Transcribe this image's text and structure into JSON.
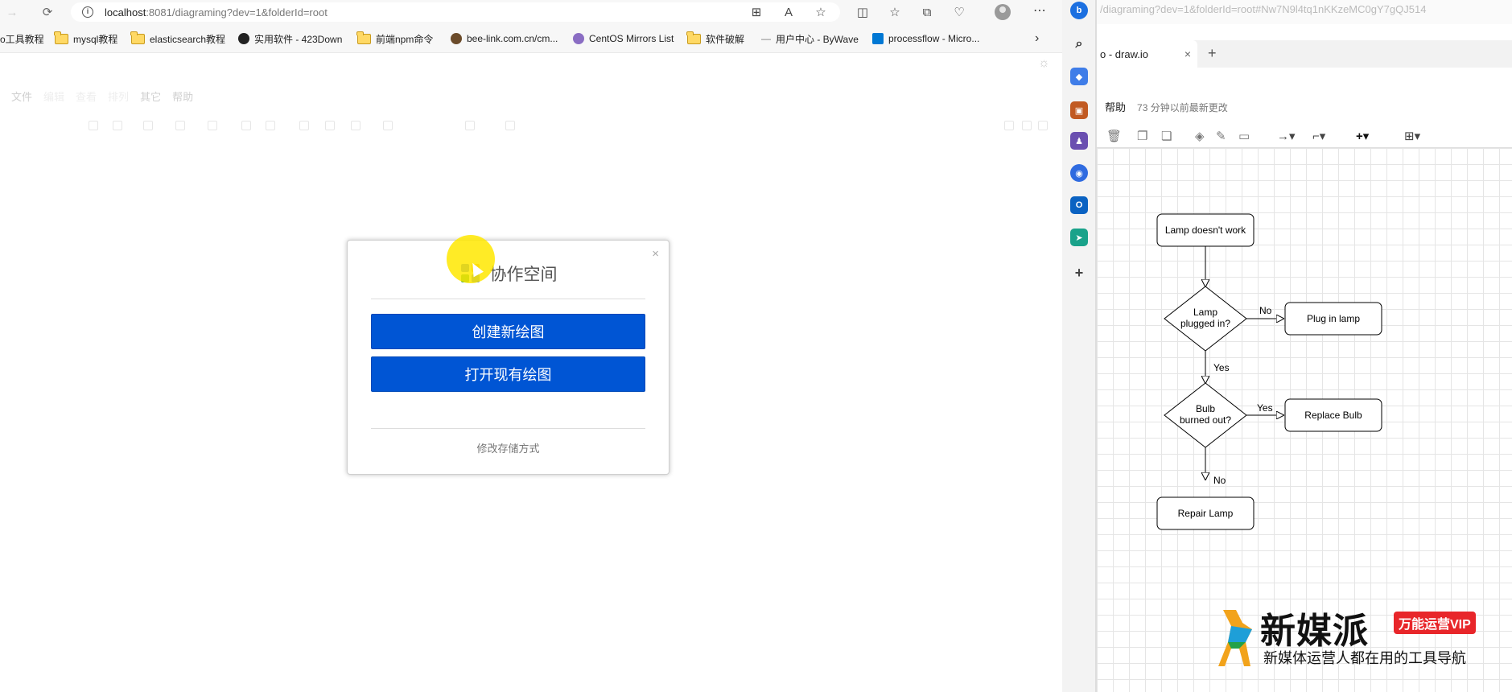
{
  "browser": {
    "url_host": "localhost",
    "url_rest": ":8081/diagraming?dev=1&folderId=root",
    "bookmarks": [
      {
        "label": "o工具教程",
        "icon": "folder"
      },
      {
        "label": "mysql教程",
        "icon": "folder"
      },
      {
        "label": "elasticsearch教程",
        "icon": "folder"
      },
      {
        "label": "实用软件 - 423Down",
        "icon": "site"
      },
      {
        "label": "前端npm命令",
        "icon": "folder"
      },
      {
        "label": "bee-link.com.cn/cm...",
        "icon": "site"
      },
      {
        "label": "CentOS Mirrors List",
        "icon": "site"
      },
      {
        "label": "软件破解",
        "icon": "folder"
      },
      {
        "label": "用户中心 - ByWave",
        "icon": "site"
      },
      {
        "label": "processflow - Micro...",
        "icon": "site"
      }
    ]
  },
  "app": {
    "menu": [
      "文件",
      "编辑",
      "查看",
      "排列",
      "其它",
      "帮助"
    ]
  },
  "dialog": {
    "title": "协作空间",
    "create_label": "创建新绘图",
    "open_label": "打开现有绘图",
    "storage_label": "修改存储方式",
    "close_label": "×"
  },
  "right_window": {
    "url_fragment": "/diagraming?dev=1&folderId=root#Nw7N9l4tq1nKKzeMC0gY7gQJ514",
    "tab_title": "o - draw.io",
    "tab_close": "×",
    "new_tab": "+",
    "menu_help": "帮助",
    "last_change": "73 分钟以前最新更改",
    "flowchart": {
      "nodes": [
        {
          "id": "start",
          "label": "Lamp doesn't work"
        },
        {
          "id": "q1_l1",
          "label": "Lamp"
        },
        {
          "id": "q1_l2",
          "label": "plugged in?"
        },
        {
          "id": "plug",
          "label": "Plug in lamp"
        },
        {
          "id": "q2_l1",
          "label": "Bulb"
        },
        {
          "id": "q2_l2",
          "label": "burned out?"
        },
        {
          "id": "replace",
          "label": "Replace Bulb"
        },
        {
          "id": "repair",
          "label": "Repair Lamp"
        }
      ],
      "edges": [
        "No",
        "Yes",
        "Yes",
        "No"
      ]
    }
  },
  "watermark": {
    "title": "新媒派",
    "badge": "万能运营VIP",
    "subtitle": "新媒体运营人都在用的工具导航"
  },
  "colors": {
    "primary_button": "#0055d4",
    "highlight": "#ffe800",
    "badge": "#e8262a"
  }
}
